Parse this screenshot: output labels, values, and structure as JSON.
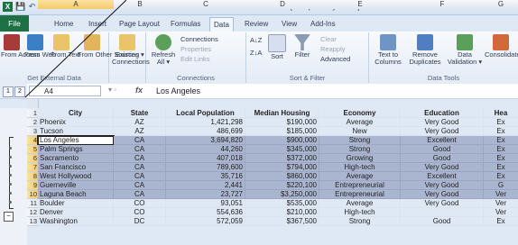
{
  "window": {
    "title": "databases [Compatibility Mode] - Microsoft Excel"
  },
  "quick_access": {
    "save": "💾",
    "undo": "↶",
    "redo": "↷"
  },
  "tabs": [
    "Home",
    "Insert",
    "Page Layout",
    "Formulas",
    "Data",
    "Review",
    "View",
    "Add-Ins"
  ],
  "file_tab": "File",
  "ribbon": {
    "get_external": {
      "label": "Get External Data",
      "buttons": [
        "From Access",
        "From Web",
        "From Text",
        "From Other Sources ▾"
      ]
    },
    "existing": "Existing Connections",
    "connections": {
      "label": "Connections",
      "refresh": "Refresh All ▾",
      "items": [
        "Connections",
        "Properties",
        "Edit Links"
      ]
    },
    "sort_filter": {
      "label": "Sort & Filter",
      "sort": "Sort",
      "filter": "Filter",
      "items": [
        "Clear",
        "Reapply",
        "Advanced"
      ]
    },
    "data_tools": {
      "label": "Data Tools",
      "text_to_columns": "Text to Columns",
      "remove_dupes": "Remove Duplicates",
      "validation": "Data Validation ▾",
      "consolidate": "Consolidate"
    }
  },
  "outline_levels": [
    "1",
    "2"
  ],
  "name_box": "A4",
  "formula": "Los Angeles",
  "fx": "fx",
  "columns": [
    "A",
    "B",
    "C",
    "D",
    "E",
    "F",
    "G"
  ],
  "headers": [
    "City",
    "State",
    "Local Population",
    "Median Housing",
    "Economy",
    "Education",
    "Hea"
  ],
  "rows": [
    {
      "n": "2",
      "cells": [
        "Phoenix",
        "AZ",
        "1,421,298",
        "$190,000",
        "Average",
        "Very Good",
        "Ex"
      ]
    },
    {
      "n": "3",
      "cells": [
        "Tucson",
        "AZ",
        "486,699",
        "$185,000",
        "New",
        "Very Good",
        "Ex"
      ]
    },
    {
      "n": "4",
      "cells": [
        "Los Angeles",
        "CA",
        "3,694,820",
        "$900,000",
        "Strong",
        "Excellent",
        "Ex"
      ]
    },
    {
      "n": "5",
      "cells": [
        "Palm Springs",
        "CA",
        "44,260",
        "$345,000",
        "Strong",
        "Good",
        "Ex"
      ]
    },
    {
      "n": "6",
      "cells": [
        "Sacramento",
        "CA",
        "407,018",
        "$372,000",
        "Growing",
        "Good",
        "Ex"
      ]
    },
    {
      "n": "7",
      "cells": [
        "San Francisco",
        "CA",
        "789,600",
        "$794,000",
        "High-tech",
        "Very Good",
        "Ex"
      ]
    },
    {
      "n": "8",
      "cells": [
        "West Hollywood",
        "CA",
        "35,716",
        "$860,000",
        "Average",
        "Excellent",
        "Ex"
      ]
    },
    {
      "n": "9",
      "cells": [
        "Guerneville",
        "CA",
        "2,441",
        "$220,100",
        "Entrepreneurial",
        "Very Good",
        "G"
      ]
    },
    {
      "n": "10",
      "cells": [
        "Laguna Beach",
        "CA",
        "23,727",
        "$3,250,000",
        "Entrepreneurial",
        "Very Good",
        "Ver"
      ]
    },
    {
      "n": "11",
      "cells": [
        "Boulder",
        "CO",
        "93,051",
        "$535,000",
        "Average",
        "Very Good",
        "Ver"
      ]
    },
    {
      "n": "12",
      "cells": [
        "Denver",
        "CO",
        "554,636",
        "$210,000",
        "High-tech",
        "",
        "Ver"
      ]
    },
    {
      "n": "13",
      "cells": [
        "Washington",
        "DC",
        "572,059",
        "$367,500",
        "Strong",
        "Good",
        "Ex"
      ]
    }
  ]
}
